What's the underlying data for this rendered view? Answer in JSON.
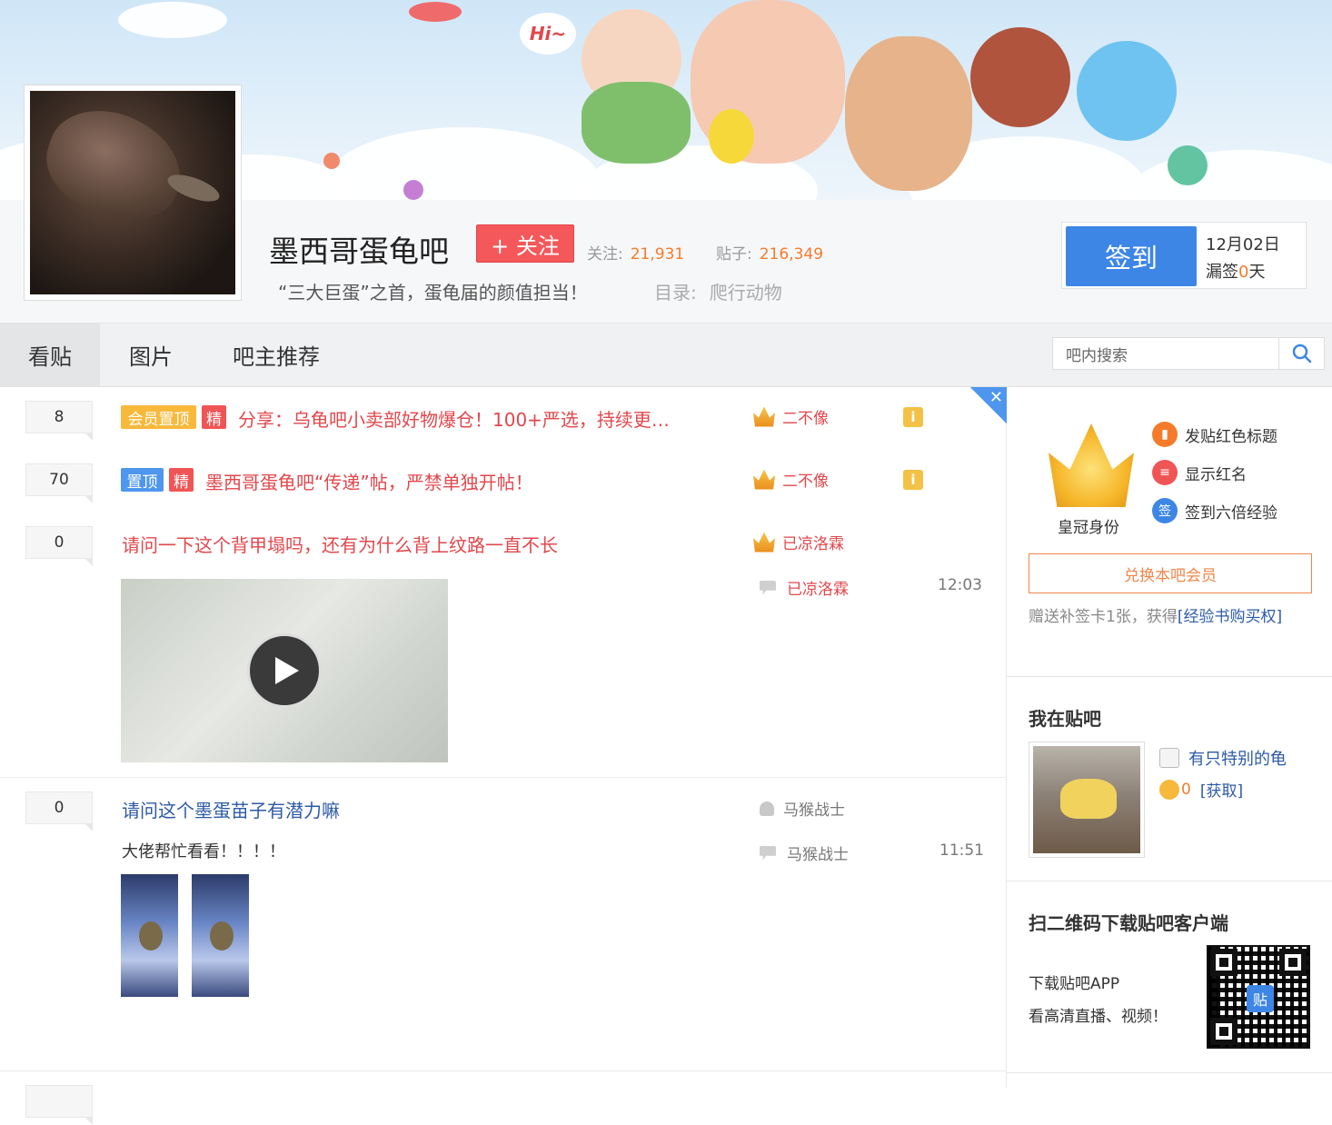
{
  "forum": {
    "name": "墨西哥蛋龟吧",
    "follow_label": "+ 关注",
    "followers_label": "关注:",
    "followers": "21,931",
    "posts_label": "贴子:",
    "posts": "216,349",
    "slogan": "“三大巨蛋”之首，蛋龟届的颜值担当！",
    "catalog_label": "目录:",
    "catalog": "爬行动物"
  },
  "banner": {
    "greeting": "Hi~"
  },
  "sign": {
    "button": "签到",
    "date": "12月02日",
    "miss_prefix": "漏签",
    "miss_count": "0",
    "miss_suffix": "天"
  },
  "nav": {
    "tabs": [
      "看贴",
      "图片",
      "吧主推荐"
    ],
    "search_placeholder": "吧内搜索"
  },
  "threads": [
    {
      "replies": "8",
      "tags": [
        "会员置顶",
        "精"
      ],
      "title": "分享：乌龟吧小卖部好物爆仓！100+严选，持续更…",
      "author": "二不像"
    },
    {
      "replies": "70",
      "tags": [
        "置顶",
        "精"
      ],
      "title": "墨西哥蛋龟吧“传递”帖，严禁单独开帖！",
      "author": "二不像"
    },
    {
      "replies": "0",
      "title": "请问一下这个背甲塌吗，还有为什么背上纹路一直不长",
      "author": "已凉洛霖",
      "last_reply_author": "已凉洛霖",
      "last_reply_time": "12:03"
    },
    {
      "replies": "0",
      "title": "请问这个墨蛋苗子有潜力嘛",
      "abstract": "大佬帮忙看看！！！！",
      "author": "马猴战士",
      "last_reply_author": "马猴战士",
      "last_reply_time": "11:51"
    }
  ],
  "sidebar": {
    "crown_label": "皇冠身份",
    "perks": [
      "发贴红色标题",
      "显示红名",
      "签到六倍经验"
    ],
    "exchange_button": "兑换本吧会员",
    "gift_text": "赠送补签卡1张，获得",
    "gift_link": "[经验书购买权]",
    "me_title": "我在贴吧",
    "user_name": "有只特别的龟",
    "coins": "0",
    "coins_link": "[获取]",
    "qr_title": "扫二维码下载贴吧客户端",
    "app_line1": "下载贴吧APP",
    "app_line2": "看高清直播、视频！",
    "qr_badge": "贴"
  },
  "colors": {
    "accent_blue": "#3d86e6",
    "follow_red": "#f4585a",
    "title_red": "#e2474c",
    "link_blue": "#2c5aa6",
    "stat_orange": "#f57b2b"
  }
}
